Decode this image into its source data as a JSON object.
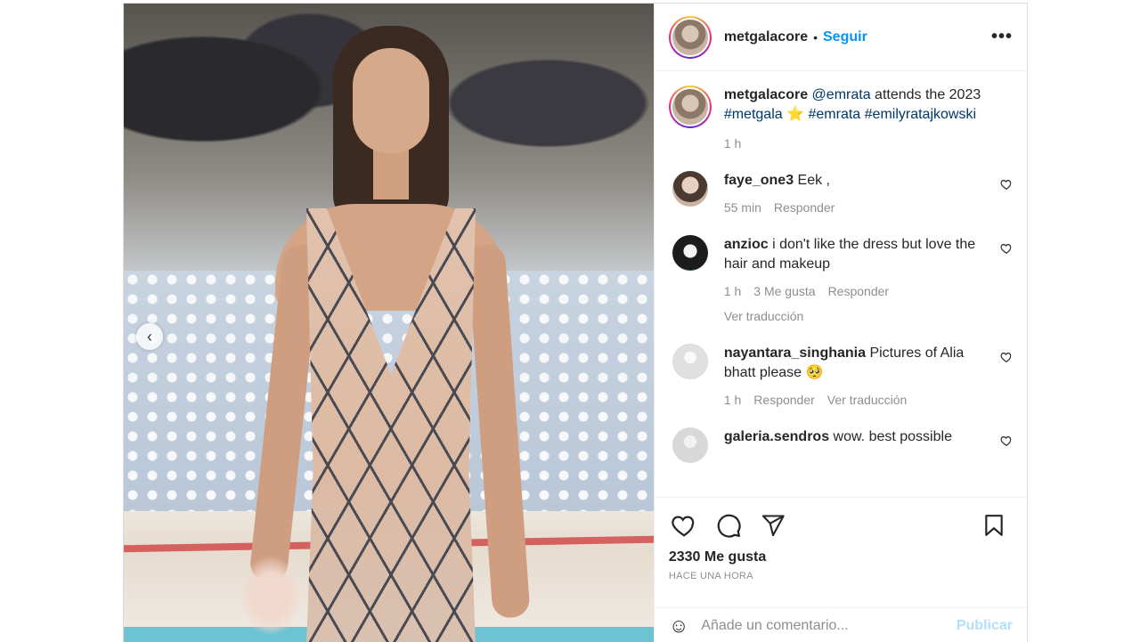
{
  "header": {
    "username": "metgalacore",
    "separator": "•",
    "follow_label": "Seguir",
    "more_icon": "more-horizontal-icon",
    "more_label": "•••"
  },
  "caption": {
    "username": "metgalacore",
    "mention": "@emrata",
    "text_1": " attends the 2023 ",
    "hashtag_1": "#metgala",
    "emoji": "⭐",
    "hashtag_2": "#emrata",
    "hashtag_3": "#emilyratajkowski",
    "time": "1 h"
  },
  "comments": [
    {
      "username": "faye_one3",
      "text": " Eek ,",
      "time": "55 min",
      "reply": "Responder"
    },
    {
      "username": "anzioc",
      "text": " i don't like the dress but love the hair and makeup",
      "time": "1 h",
      "likes": "3 Me gusta",
      "reply": "Responder",
      "translate": "Ver traducción"
    },
    {
      "username": "nayantara_singhania",
      "text": " Pictures of Alia bhatt please 🥺",
      "time": "1 h",
      "reply": "Responder",
      "translate": "Ver traducción"
    },
    {
      "username": "galeria.sendros",
      "text": " wow. best possible"
    }
  ],
  "actions": {
    "likes": "2330 Me gusta",
    "posted": "HACE UNA HORA"
  },
  "add_comment": {
    "emoji_icon": "☺",
    "placeholder": "Añade un comentario...",
    "post_label": "Publicar"
  },
  "media": {
    "prev_label": "‹"
  },
  "colors": {
    "accent": "#0095f6",
    "link": "#00376b",
    "muted": "#8e8e8e",
    "post_disabled": "#b2dffc"
  }
}
